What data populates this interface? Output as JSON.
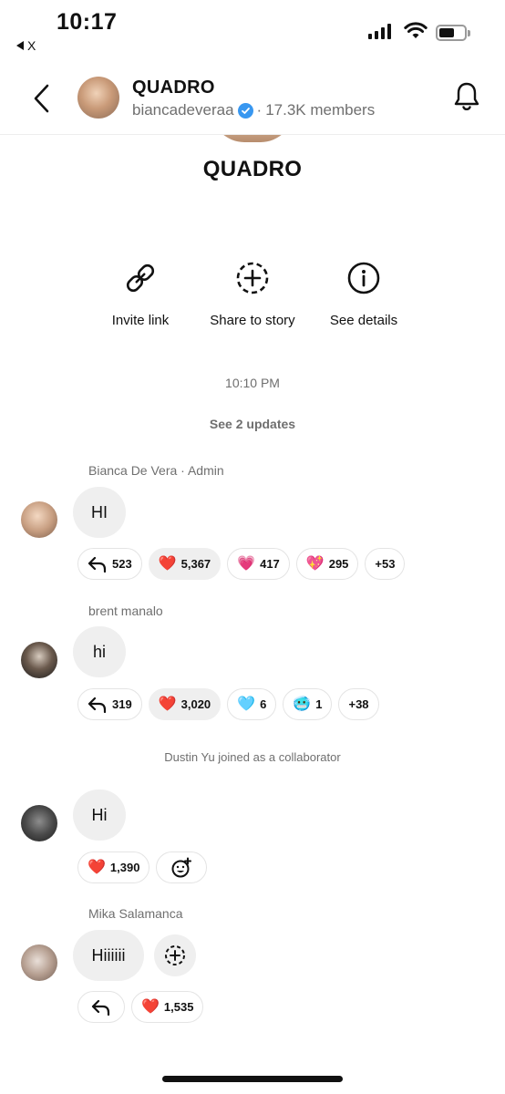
{
  "status_bar": {
    "time": "10:17",
    "back_app": "X"
  },
  "header": {
    "title": "QUADRO",
    "username": "biancadeveraa",
    "separator": "·",
    "members": "17.3K members"
  },
  "channel": {
    "name": "QUADRO"
  },
  "actions": [
    {
      "label": "Invite link",
      "icon": "link-icon"
    },
    {
      "label": "Share to story",
      "icon": "add-story-icon"
    },
    {
      "label": "See details",
      "icon": "info-icon"
    }
  ],
  "feed": {
    "timestamp": "10:10 PM",
    "see_updates": "See 2 updates",
    "system_message": "Dustin Yu joined as a collaborator",
    "messages": [
      {
        "sender": "Bianca De Vera · Admin",
        "text": "HI",
        "reactions": [
          {
            "emoji": "reply",
            "count": "523"
          },
          {
            "emoji": "❤️",
            "count": "5,367"
          },
          {
            "emoji": "💗",
            "count": "417"
          },
          {
            "emoji": "💖",
            "count": "295"
          },
          {
            "emoji": "",
            "count": "+53"
          }
        ]
      },
      {
        "sender": "brent manalo",
        "text": "hi",
        "reactions": [
          {
            "emoji": "reply",
            "count": "319"
          },
          {
            "emoji": "❤️",
            "count": "3,020"
          },
          {
            "emoji": "🩵",
            "count": "6"
          },
          {
            "emoji": "🥶",
            "count": "1"
          },
          {
            "emoji": "",
            "count": "+38"
          }
        ]
      },
      {
        "sender": "",
        "text": "Hi",
        "reactions": [
          {
            "emoji": "❤️",
            "count": "1,390"
          }
        ]
      },
      {
        "sender": "Mika Salamanca",
        "text": "Hiiiiii",
        "reactions": [
          {
            "emoji": "❤️",
            "count": "1,535"
          }
        ]
      }
    ]
  },
  "colors": {
    "accent": "#3897f0",
    "bubble": "#efefef",
    "muted_text": "#6f6f6f"
  }
}
